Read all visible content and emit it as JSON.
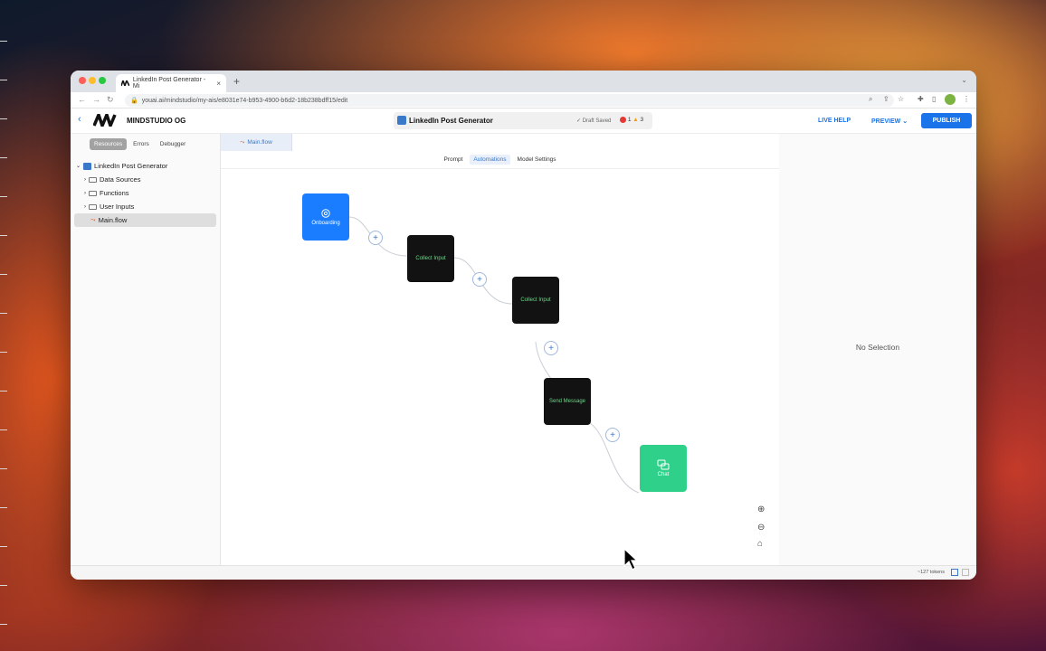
{
  "browser": {
    "tab_title": "LinkedIn Post Generator - Mi",
    "tab_close": "×",
    "new_tab": "+",
    "url": "youai.ai/mindstudio/my-ais/e8031e74-b953-4900-b6d2-18b238bdff15/edit"
  },
  "app": {
    "brand": "MINDSTUDIO OG",
    "project_name": "LinkedIn Post Generator",
    "draft_status": "✓ Draft Saved",
    "errors_count": "1",
    "warnings_count": "3",
    "live_help": "LIVE HELP",
    "preview": "PREVIEW ⌄",
    "publish": "PUBLISH"
  },
  "sidebar": {
    "tabs": [
      "Resources",
      "Errors",
      "Debugger"
    ],
    "tree": {
      "root": "LinkedIn Post Generator",
      "items": [
        "Data Sources",
        "Functions",
        "User Inputs"
      ],
      "selected": "Main.flow"
    }
  },
  "editor": {
    "file_tab": "Main.flow",
    "subtabs": [
      "Prompt",
      "Automations",
      "Model Settings"
    ],
    "active_subtab": "Automations",
    "nodes": [
      {
        "label": "Onboarding"
      },
      {
        "label": "Collect Input"
      },
      {
        "label": "Collect Input"
      },
      {
        "label": "Send Message"
      },
      {
        "label": "Chat"
      }
    ]
  },
  "right_panel": {
    "empty_text": "No Selection"
  },
  "status_bar": {
    "tokens": "~127 tokens"
  },
  "colors": {
    "accent": "#1a73e8",
    "node_start": "#1a7cff",
    "node_dark": "#121212",
    "node_end": "#2fd08a"
  }
}
